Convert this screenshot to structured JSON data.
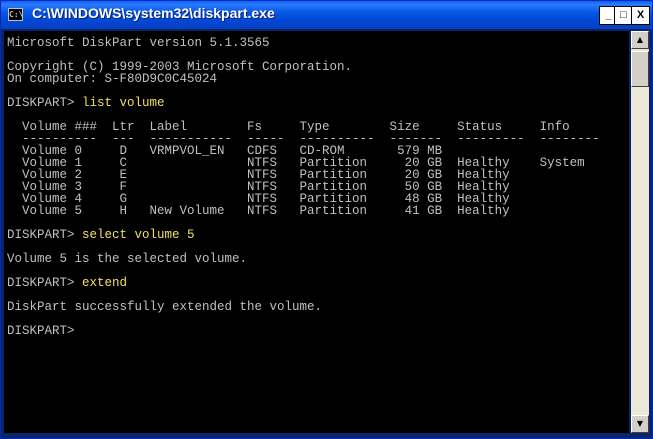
{
  "window": {
    "title": "C:\\WINDOWS\\system32\\diskpart.exe",
    "icon_text": "C:\\",
    "min_label": "_",
    "max_label": "□",
    "close_label": "X"
  },
  "console": {
    "version_line": "Microsoft DiskPart version 5.1.3565",
    "copyright_line": "Copyright (C) 1999-2003 Microsoft Corporation.",
    "computer_line": "On computer: S-F80D9C0C45024",
    "prompt": "DISKPART> ",
    "commands": [
      "list volume",
      "select volume 5",
      "extend"
    ],
    "table": {
      "header": "  Volume ###  Ltr  Label        Fs     Type        Size     Status     Info",
      "separator": "  ----------  ---  -----------  -----  ----------  -------  ---------  --------",
      "rows": [
        "  Volume 0     D   VRMPVOL_EN   CDFS   CD-ROM       579 MB",
        "  Volume 1     C                NTFS   Partition     20 GB  Healthy    System",
        "  Volume 2     E                NTFS   Partition     20 GB  Healthy",
        "  Volume 3     F                NTFS   Partition     50 GB  Healthy",
        "  Volume 4     G                NTFS   Partition     48 GB  Healthy",
        "  Volume 5     H   New Volume   NTFS   Partition     41 GB  Healthy"
      ]
    },
    "select_result": "Volume 5 is the selected volume.",
    "extend_result": "DiskPart successfully extended the volume."
  },
  "scrollbar": {
    "up_icon": "scroll-up-arrow-icon",
    "down_icon": "scroll-down-arrow-icon",
    "up_glyph": "▲",
    "down_glyph": "▼"
  },
  "colors": {
    "titlebar": "#0058e6",
    "console_bg": "#000000",
    "console_text": "#c0c0c0",
    "command_text": "#f0e060"
  }
}
